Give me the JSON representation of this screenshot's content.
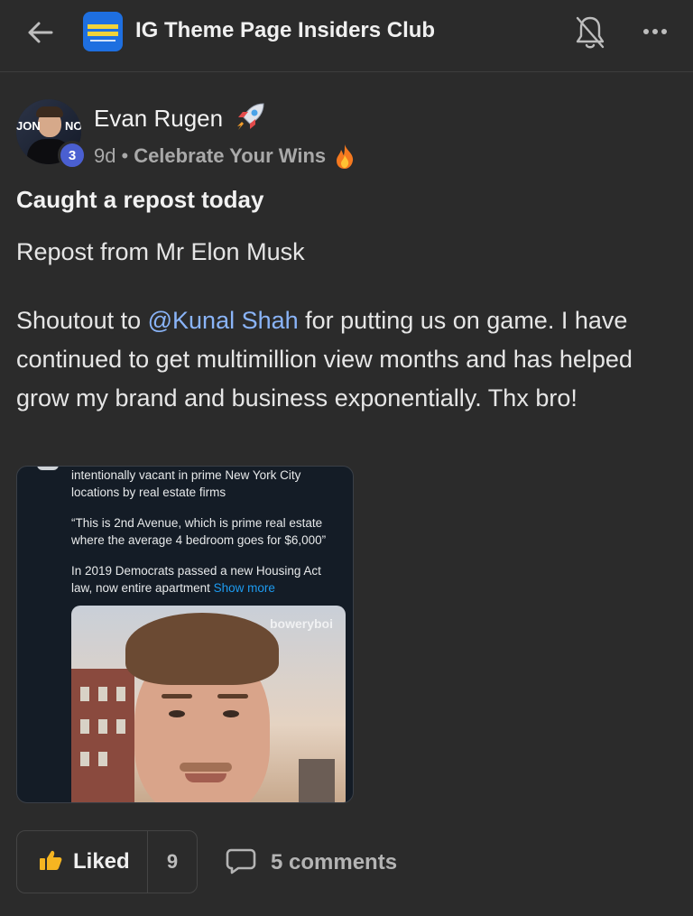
{
  "header": {
    "group_title": "IG Theme Page Insiders Club",
    "icons": [
      "back-arrow-icon",
      "group-logo",
      "bell-off-icon",
      "more-icon"
    ]
  },
  "post": {
    "author": {
      "name": "Evan Rugen",
      "name_emoji": "rocket-emoji",
      "level": "3",
      "avatar_text_left": "JON",
      "avatar_text_right": "NO"
    },
    "time": "9d",
    "separator": "•",
    "category": "Celebrate Your Wins",
    "category_emoji": "fire-emoji",
    "title": "Caught a repost today",
    "body_line1": "Repost from Mr Elon Musk",
    "body_p2_before": "Shoutout to ",
    "mention": "@Kunal Shah",
    "body_p2_after": " for putting us on game. I have continued to get multimillion view months and has helped grow my brand and business exponentially. Thx bro!",
    "media": {
      "tweet_p1": "intentionally vacant in prime New York City locations by real estate firms",
      "tweet_p2": "“This is 2nd Avenue, which is prime real estate where the average 4 bedroom goes for $6,000”",
      "tweet_p3": "In 2019 Democrats passed a new Housing Act law, now entire apartment",
      "show_more": "Show more",
      "watermark": "boweryboi"
    },
    "actions": {
      "liked_label": "Liked",
      "like_count": "9",
      "comments_label": "5 comments"
    }
  },
  "colors": {
    "background": "#2b2b2b",
    "mention": "#8ab4f8",
    "badge": "#4a5fd1",
    "link_blue": "#1d9bf0"
  }
}
